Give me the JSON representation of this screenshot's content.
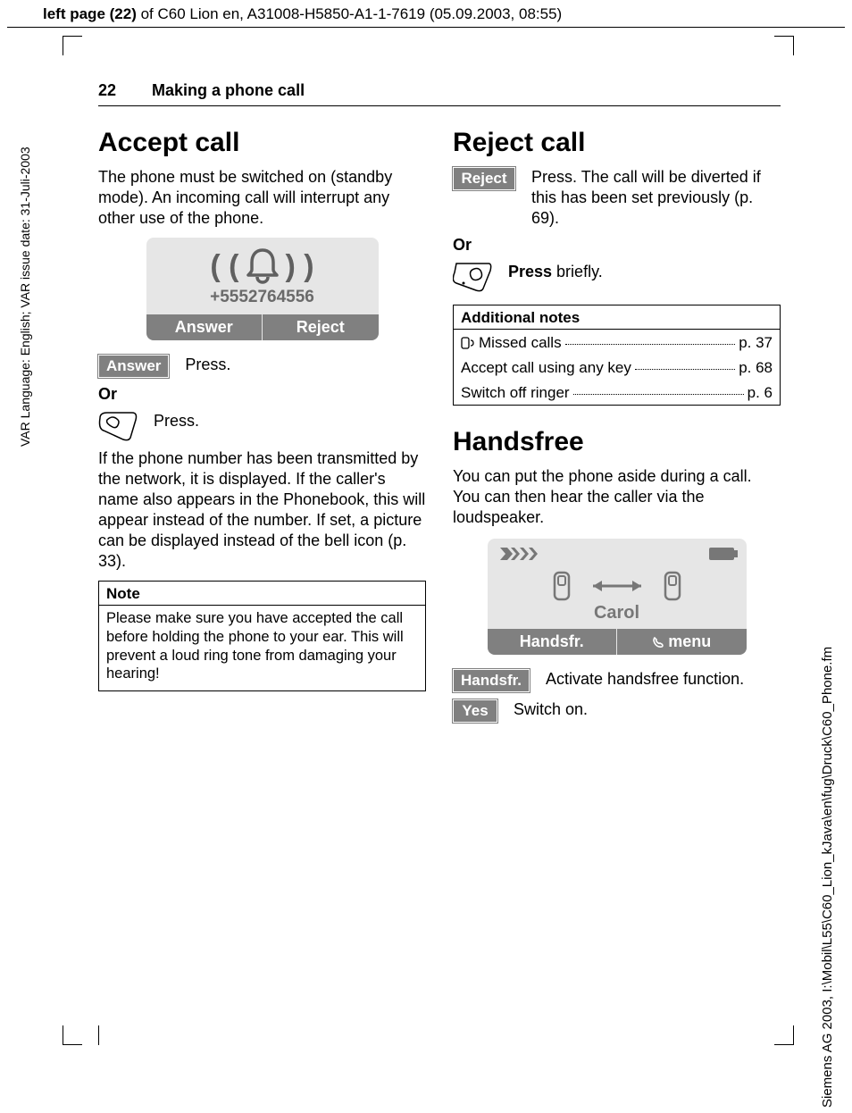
{
  "top_header": {
    "bold": "left page (22)",
    "rest": " of C60 Lion en, A31008-H5850-A1-1-7619 (05.09.2003, 08:55)"
  },
  "left_side_text": "VAR Language: English; VAR issue date: 31-Juli-2003",
  "right_side_text": "Siemens AG 2003, I:\\Mobil\\L55\\C60_Lion_kJava\\en\\fug\\Druck\\C60_Phone.fm",
  "page_number": "22",
  "running_title": "Making a phone call",
  "accept": {
    "h": "Accept call",
    "p1": "The phone must be switched on (standby mode). An incoming call will interrupt any other use of the phone.",
    "caller_number": "+5552764556",
    "sk_left": "Answer",
    "sk_right": "Reject",
    "answer_label": "Answer",
    "answer_text": "Press.",
    "or": "Or",
    "call_key_text": "Press.",
    "p2": "If the phone number has been transmitted by the network, it is displayed. If the caller's name also appears in the Phonebook, this will appear instead of the number. If set, a picture can be displayed instead of the bell icon (p. 33).",
    "note_h": "Note",
    "note_b": "Please make sure you have accepted the call before holding the phone to your ear. This will prevent a loud ring tone from damaging your hearing!"
  },
  "reject": {
    "h": "Reject call",
    "reject_label": "Reject",
    "reject_text": "Press. The call will be diverted if this has been set previously (p. 69).",
    "or": "Or",
    "end_key_text_bold": "Press",
    "end_key_text_rest": " briefly.",
    "add_h": "Additional notes",
    "rows": [
      {
        "label": "Missed calls",
        "page": "p. 37",
        "icon": true
      },
      {
        "label": "Accept call using any key ",
        "page": "p. 68",
        "icon": false
      },
      {
        "label": "Switch off ringer",
        "page": "p. 6",
        "icon": false
      }
    ]
  },
  "handsfree": {
    "h": "Handsfree",
    "p": "You can put the phone aside during a call. You can then hear the caller via the loudspeaker.",
    "caller": "Carol",
    "sk_left": "Handsfr.",
    "sk_right": "menu",
    "hf_label": "Handsfr.",
    "hf_text": "Activate handsfree function.",
    "yes_label": "Yes",
    "yes_text": "Switch on."
  }
}
